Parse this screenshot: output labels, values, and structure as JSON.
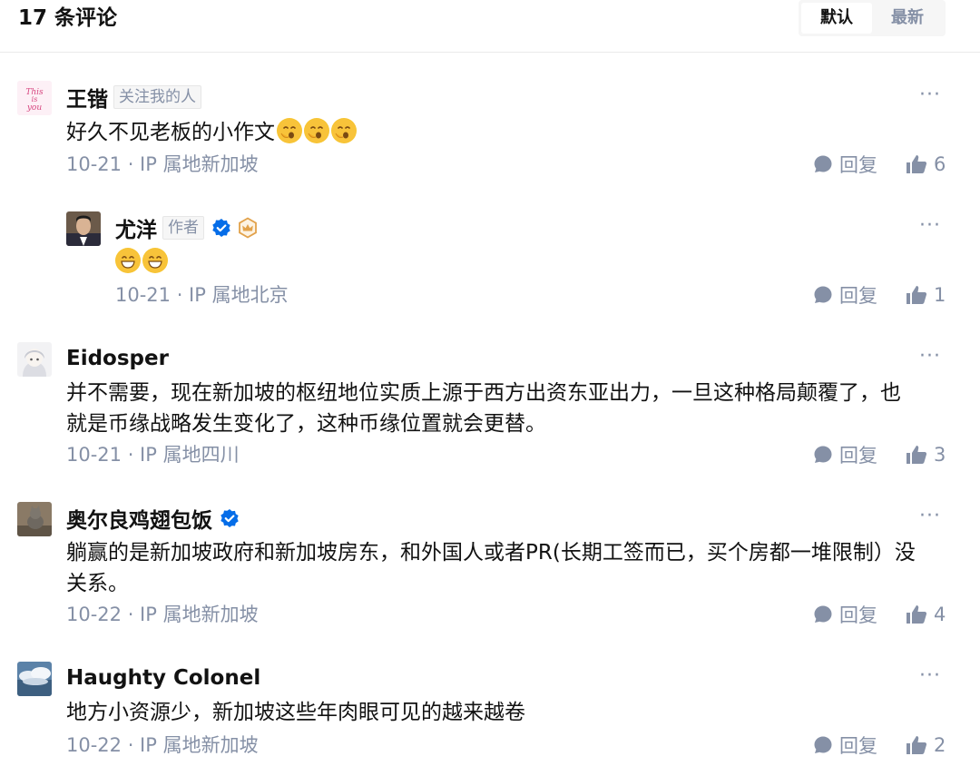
{
  "header": {
    "title": "17 条评论",
    "sort": {
      "default_label": "默认",
      "latest_label": "最新"
    }
  },
  "comments": [
    {
      "name": "王锴",
      "tag": "关注我的人",
      "text": "好久不见老板的小作文",
      "emoji": [
        "yawn-emoji",
        "yawn-emoji",
        "yawn-emoji"
      ],
      "meta": "10-21 · IP 属地新加坡",
      "reply_label": "回复",
      "likes": "6"
    },
    {
      "name": "尤洋",
      "tag": "作者",
      "verified": true,
      "emoji": [
        "grin-emoji",
        "grin-emoji"
      ],
      "meta": "10-21 · IP 属地北京",
      "reply_label": "回复",
      "likes": "1"
    },
    {
      "name": "Eidosper",
      "text_line1": "并不需要，现在新加坡的枢纽地位实质上源于西方出资东亚出力，一旦这种格局颠覆了，也",
      "text_line2": "就是币缘战略发生变化了，这种币缘位置就会更替。",
      "meta": "10-21 · IP 属地四川",
      "reply_label": "回复",
      "likes": "3"
    },
    {
      "name": "奥尔良鸡翅包饭",
      "verified": true,
      "text_line1": "躺赢的是新加坡政府和新加坡房东，和外国人或者PR(长期工签而已，买个房都一堆限制）没",
      "text_line2": "关系。",
      "meta": "10-22 · IP 属地新加坡",
      "reply_label": "回复",
      "likes": "4"
    },
    {
      "name": "Haughty Colonel",
      "text": "地方小资源少，新加坡这些年肉眼可见的越来越卷",
      "meta": "10-22 · IP 属地新加坡",
      "reply_label": "回复",
      "likes": "2"
    }
  ],
  "colors": {
    "accent": "#056de8",
    "muted": "#8590a6",
    "text": "#121212",
    "crown": "#e2a24b"
  }
}
